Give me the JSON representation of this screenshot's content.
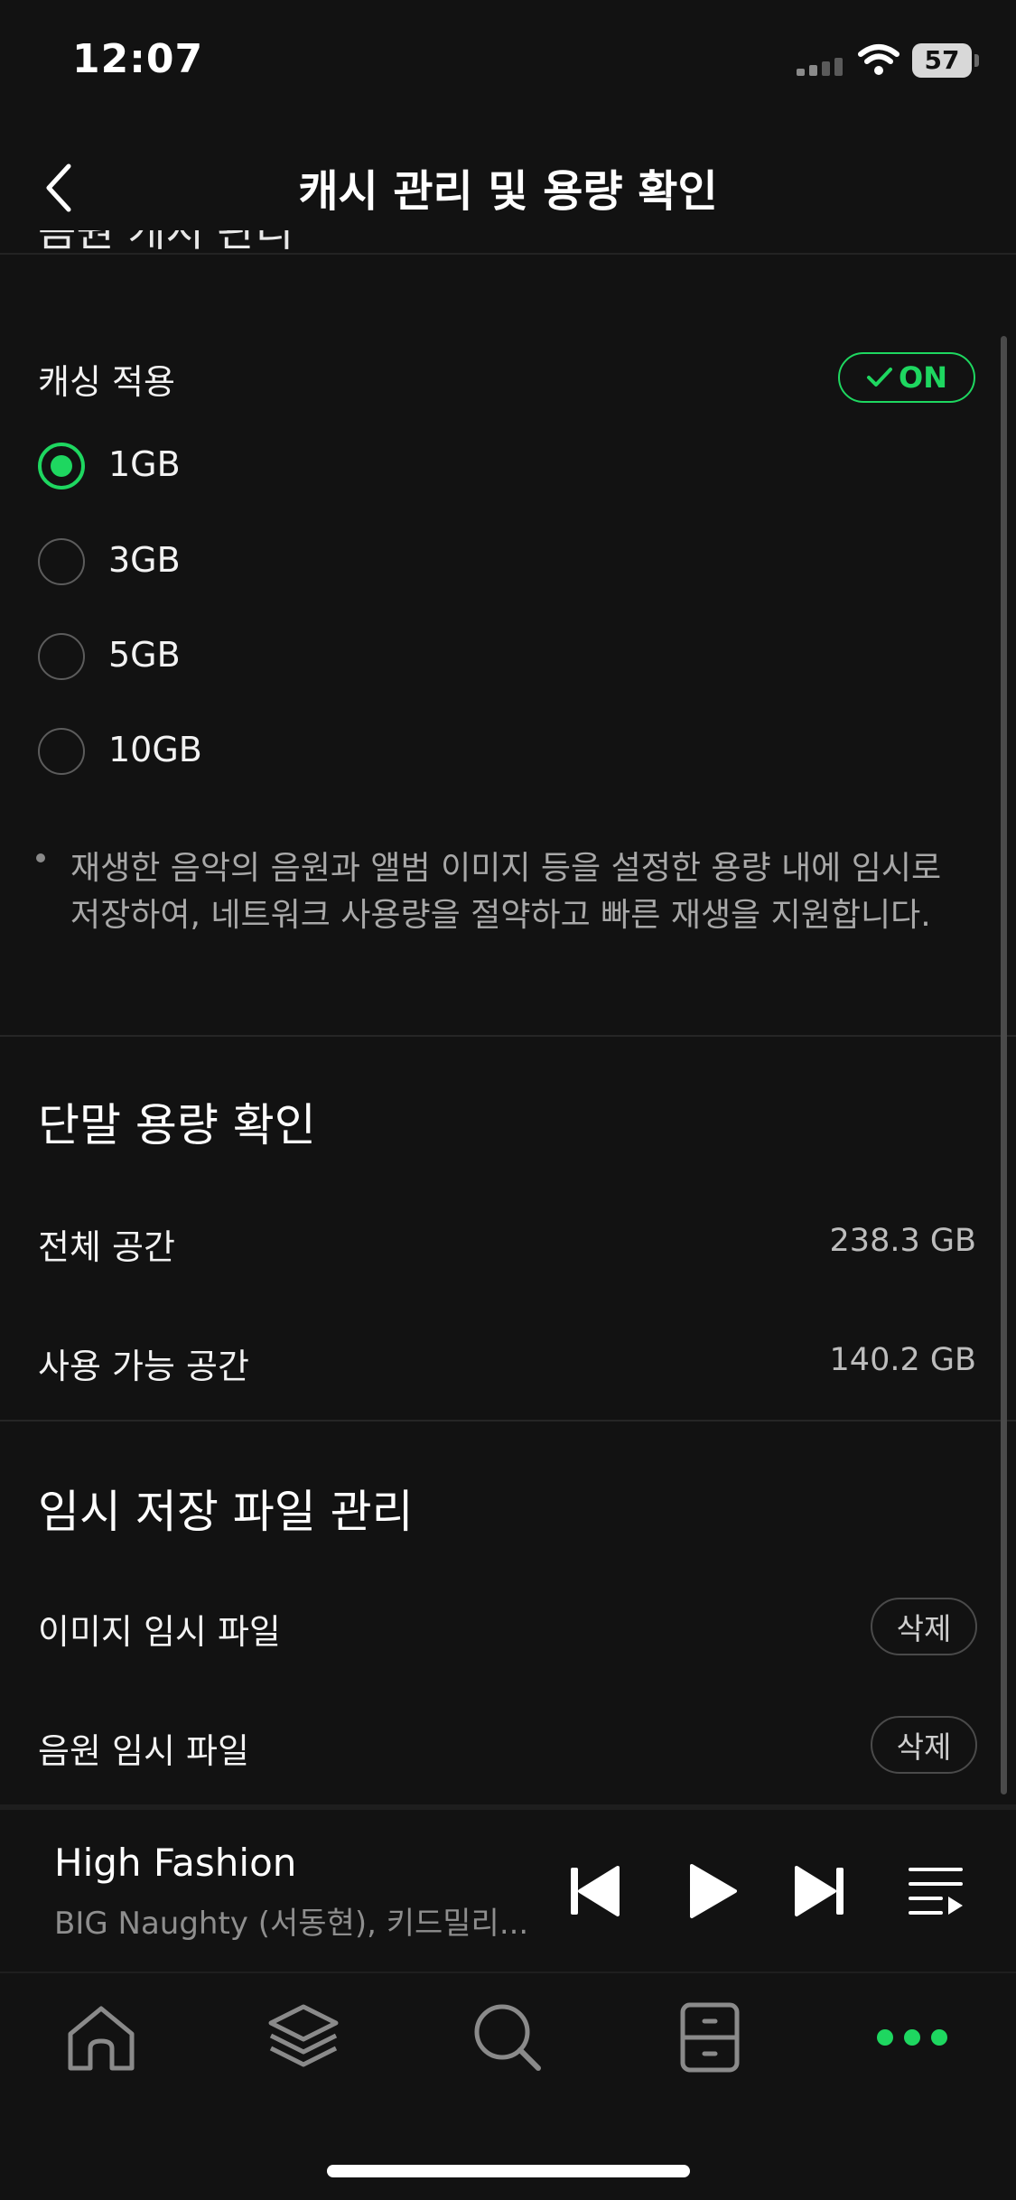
{
  "status_bar": {
    "time": "12:07",
    "battery": "57"
  },
  "header": {
    "title": "캐시 관리 및 용량 확인"
  },
  "cache_section": {
    "heading_partial": "음원 캐시 관리",
    "caching_label": "캐싱 적용",
    "toggle_label": "ON",
    "options": [
      {
        "label": "1GB",
        "selected": true
      },
      {
        "label": "3GB",
        "selected": false
      },
      {
        "label": "5GB",
        "selected": false
      },
      {
        "label": "10GB",
        "selected": false
      }
    ],
    "note": "재생한 음악의 음원과 앨범 이미지 등을 설정한 용량 내에 임시로 저장하여, 네트워크 사용량을 절약하고 빠른 재생을 지원합니다."
  },
  "storage_section": {
    "title": "단말 용량 확인",
    "rows": [
      {
        "label": "전체 공간",
        "value": "238.3 GB"
      },
      {
        "label": "사용 가능 공간",
        "value": "140.2 GB"
      }
    ]
  },
  "temp_section": {
    "title": "임시 저장 파일 관리",
    "rows": [
      {
        "label": "이미지 임시 파일",
        "button": "삭제"
      },
      {
        "label": "음원 임시 파일",
        "button": "삭제"
      }
    ]
  },
  "player": {
    "title": "High Fashion",
    "artist": "BIG Naughty (서동현), 키드밀리..."
  },
  "colors": {
    "accent": "#1ed760",
    "background": "#121212"
  },
  "bottom_nav": {
    "icons": [
      "home-icon",
      "layers-icon",
      "search-icon",
      "library-icon",
      "more-icon"
    ],
    "active": "more-icon"
  }
}
